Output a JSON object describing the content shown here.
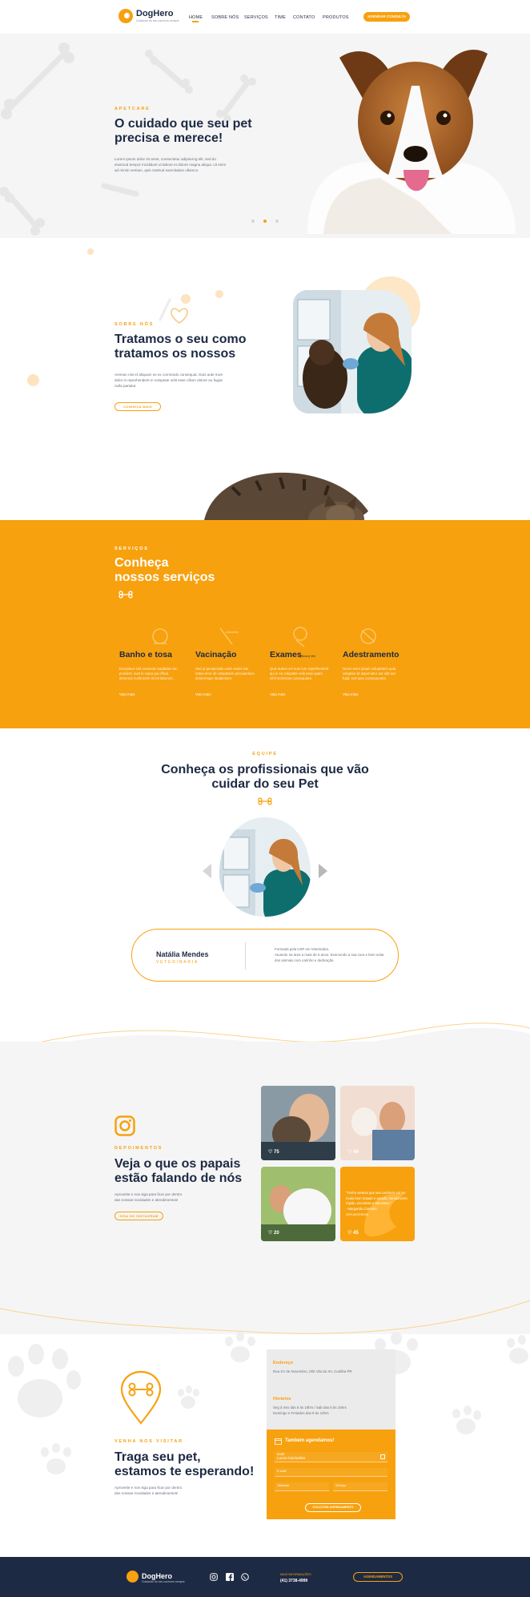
{
  "header": {
    "brand": "DogHero",
    "tagline": "Cuidando do seu cachorro sempre",
    "nav": [
      "HOME",
      "SOBRE NÓS",
      "SERVIÇOS",
      "TIME",
      "CONTATO",
      "PRODUTOS"
    ],
    "cta": "AGENDAR CONSULTA"
  },
  "hero": {
    "label": "APETCARE",
    "title_line1": "O cuidado que seu pet",
    "title_line2": "precisa e merece!",
    "text_line1": "Lorem ipsum dolor sit amet, consectetur adipiscing elit, sed do",
    "text_line2": "eiusmod tempor incididunt ut labore et dolore magna aliqua. Ut enim",
    "text_line3": "ad minim veniam, quis nostrud exercitation ullamco."
  },
  "about": {
    "label": "SOBRE NÓS",
    "title_line1": "Tratamos o seu como",
    "title_line2": "tratamos os nossos",
    "text_line1": "Aenean nisi et aliquam ex ex commodo consequat. Duis aute irure",
    "text_line2": "dolor in reprehenderit in voluptate velit esse cillum dolore eu fugiat",
    "text_line3": "nulla pariatur.",
    "button": "CONHEÇA MAIS"
  },
  "services": {
    "label": "SERVIÇOS",
    "title_line1": "Conheça",
    "title_line2": "nossos serviços",
    "items": [
      {
        "title": "Banho e tosa",
        "badge": "",
        "desc1": "Excepteur sint occaecat cupidatat non",
        "desc2": "proident, sunt in culpa qui officia",
        "desc3": "deserunt mollit anim id est laborum.",
        "more": "Veja mais"
      },
      {
        "title": "Vacinação",
        "badge": "",
        "desc1": "Sed ut perspiciatis unde omnis iste",
        "desc2": "natus error sit voluptatem accusantium",
        "desc3": "doloremque laudantium.",
        "more": "Veja mais"
      },
      {
        "title": "Exames",
        "badge": "(Novo) Ver",
        "desc1": "Quis autem vel eum iure reprehenderit",
        "desc2": "qui in ea voluptate velit esse quam",
        "desc3": "nihil molestiae consequatur.",
        "more": "Veja mais"
      },
      {
        "title": "Adestramento",
        "badge": "",
        "desc1": "Nemo enim ipsam voluptatem quia",
        "desc2": "voluptas sit aspernatur aut odit aut",
        "desc3": "fugit, sed quia consequuntur.",
        "more": "Veja mais"
      }
    ]
  },
  "team": {
    "label": "EQUIPE",
    "title_line1": "Conheça os profissionais que vão",
    "title_line2": "cuidar do seu Pet",
    "name": "Natália Mendes",
    "role": "VETERINÁRIA",
    "bio1": "Formada pela USP em Veterinária.",
    "bio2": "Atuando na área a mais de 5 anos. Exercendo a sua cura e bem estar",
    "bio3": "dos animais com carinho e dedicação."
  },
  "testimonials": {
    "label": "DEPOIMENTOS",
    "title_line1": "Veja o que os papais",
    "title_line2": "estão falando de nós",
    "text_line1": "Aproveite e nos siga para ficar por dentro",
    "text_line2": "das nossas novidades e atendimentos!",
    "button": "SIGA NO INSTAGRAM",
    "likes": [
      "75",
      "48",
      "20",
      "45"
    ],
    "quote1": "\"Tenho certeza que seu cachorro vai ser",
    "quote2": "muito bem tratado e amado. Atendimento",
    "quote3": "rápido, excelente e atencioso.\"",
    "quote4": "- Margarida Carneiro",
    "quote_more": "VER ANTERIOR"
  },
  "visit": {
    "label": "VENHA NOS VISITAR",
    "title_line1": "Traga seu pet,",
    "title_line2": "estamos te esperando!",
    "text_line1": "Aproveite e nos siga para ficar por dentro",
    "text_line2": "das nossas novidades e atendimentos!",
    "address_label": "Endereço",
    "address": "Rua XV de Novembro, 000 Vila da XV, Curitiba PR",
    "hours_label": "Horários",
    "hours1": "Seg à Sex das 8 às 18hrs / Sab das 8 às 16hrs",
    "hours2": "Domingo e Feriados das 8 às 12hrs",
    "form_title": "Também agendamos!",
    "field_name_label": "NOME",
    "field_name_value": "Lucas Guimarães",
    "field_email": "E-mail",
    "field_phone": "Telefone",
    "field_service": "Serviço",
    "submit": "SOLICITAR AGENDAMENTO"
  },
  "footer": {
    "brand": "DogHero",
    "tagline": "Cuidando do seu cachorro sempre",
    "info_label": "MAIS INFORMAÇÕES",
    "phone": "(41) 3738-4999",
    "cta": "AGENDAMENTOS"
  },
  "colors": {
    "accent": "#f7a10f",
    "navy": "#1d2a44",
    "light_bg": "#f5f5f5"
  }
}
